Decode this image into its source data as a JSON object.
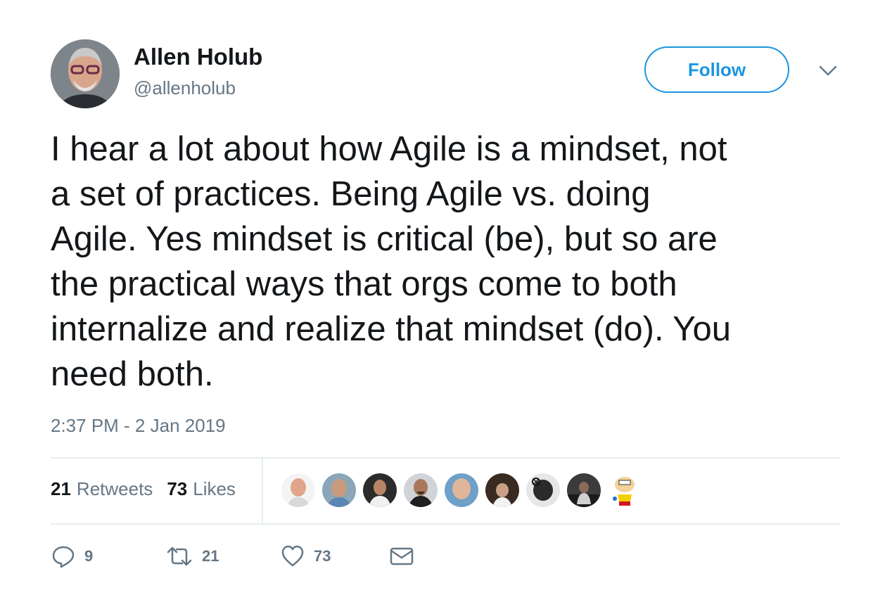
{
  "author": {
    "name": "Allen Holub",
    "handle": "@allenholub"
  },
  "follow_label": "Follow",
  "tweet": {
    "text": "I hear a lot about how Agile is a mindset, not\na set of practices. Being Agile vs. doing\nAgile. Yes mindset is critical (be), but so are\nthe practical ways that orgs come to both\ninternalize and realize that mindset (do). You\nneed both.",
    "timestamp": "2:37 PM - 2 Jan 2019"
  },
  "stats": {
    "retweets_count": "21",
    "retweets_label": "Retweets",
    "likes_count": "73",
    "likes_label": "Likes"
  },
  "actions": {
    "reply_count": "9",
    "retweet_count": "21",
    "like_count": "73"
  },
  "icons": [
    "chevron-down-icon",
    "reply-icon",
    "retweet-icon",
    "like-icon",
    "direct-message-icon"
  ],
  "colors": {
    "accent": "#1b95e0",
    "secondary_text": "#657786",
    "primary_text": "#14171a",
    "divider": "#e6ecf0"
  }
}
